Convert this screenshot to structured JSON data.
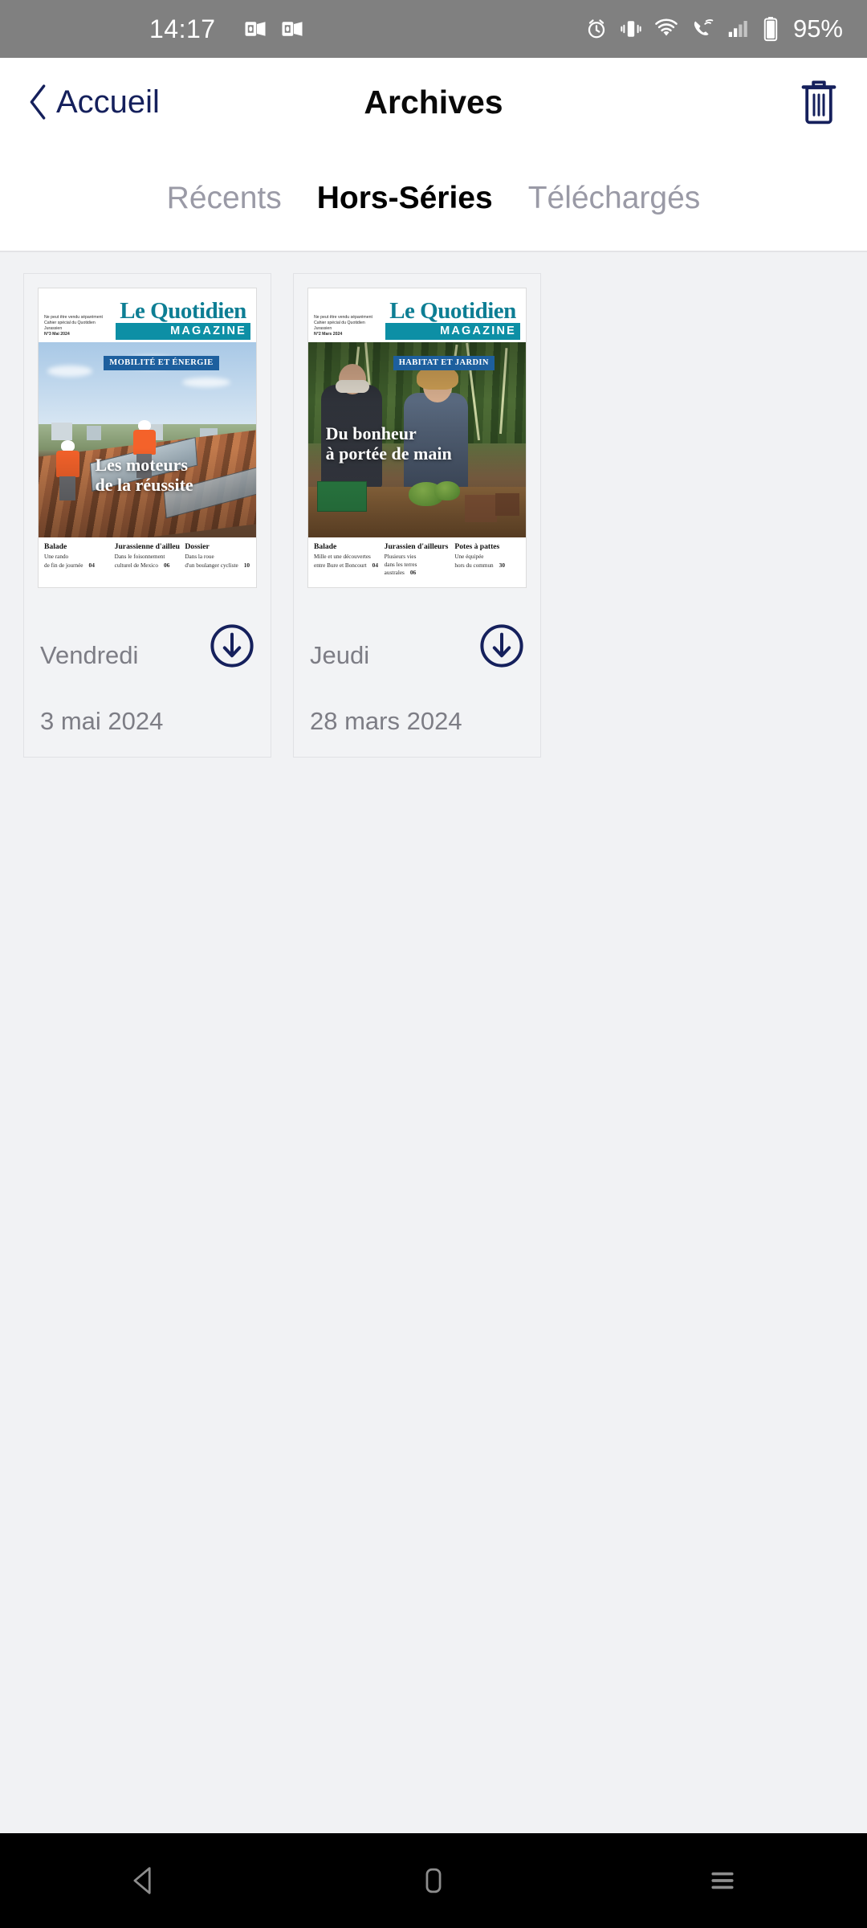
{
  "status_bar": {
    "time": "14:17",
    "battery_percent": "95%",
    "left_icons": [
      "outlook-icon",
      "outlook-icon"
    ],
    "right_icons": [
      "alarm-icon",
      "vibrate-icon",
      "wifi-icon",
      "wifi-calling-icon",
      "signal-icon",
      "battery-icon"
    ]
  },
  "nav": {
    "back_label": "Accueil",
    "title": "Archives",
    "delete_icon": "trash-icon"
  },
  "tabs": [
    {
      "label": "Récents",
      "active": false
    },
    {
      "label": "Hors-Séries",
      "active": true
    },
    {
      "label": "Téléchargés",
      "active": false
    }
  ],
  "colors": {
    "accent_navy": "#15205c",
    "teal": "#0d8fa5",
    "badge_blue": "#1d5f9e",
    "tab_inactive": "#9a9aa6",
    "page_bg": "#f1f2f4",
    "status_bar_bg": "#808080"
  },
  "issues": [
    {
      "cover": {
        "fineprint_line1": "Ne peut être vendu séparément",
        "fineprint_line2": "Cahier spécial du Quotidien Jurassien",
        "fineprint_line3": "N°3 Mai 2024",
        "logo_title": "Le Quotidien",
        "logo_sub": "MAGAZINE",
        "badge": "MOBILITÉ ET ÉNERGIE",
        "headline": "Les moteurs\nde la réussite",
        "teasers": [
          {
            "title": "Balade",
            "line1": "Une rando",
            "line2": "de fin de journée",
            "page": "04"
          },
          {
            "title": "Jurassienne d'ailleurs",
            "line1": "Dans le foisonnement",
            "line2": "culturel de Mexico",
            "page": "06"
          },
          {
            "title": "Dossier",
            "line1": "Dans la roue",
            "line2": "d'un boulanger cycliste",
            "page": "10"
          }
        ]
      },
      "day": "Vendredi",
      "date": "3 mai 2024",
      "download_icon": "download-circle-icon"
    },
    {
      "cover": {
        "fineprint_line1": "Ne peut être vendu séparément",
        "fineprint_line2": "Cahier spécial du Quotidien Jurassien",
        "fineprint_line3": "N°2 Mars 2024",
        "logo_title": "Le Quotidien",
        "logo_sub": "MAGAZINE",
        "badge": "HABITAT ET JARDIN",
        "headline": "Du bonheur\nà portée de main",
        "teasers": [
          {
            "title": "Balade",
            "line1": "Mille et une découvertes",
            "line2": "entre Bure et Boncourt",
            "page": "04"
          },
          {
            "title": "Jurassien d'ailleurs",
            "line1": "Plusieurs vies",
            "line2": "dans les terres australes",
            "page": "06"
          },
          {
            "title": "Potes à pattes",
            "line1": "Une équipée",
            "line2": "hors du commun",
            "page": "30"
          }
        ]
      },
      "day": "Jeudi",
      "date": "28 mars 2024",
      "download_icon": "download-circle-icon"
    }
  ],
  "system_nav": {
    "back": "back-triangle-icon",
    "home": "home-pill-icon",
    "recents": "recents-lines-icon"
  }
}
